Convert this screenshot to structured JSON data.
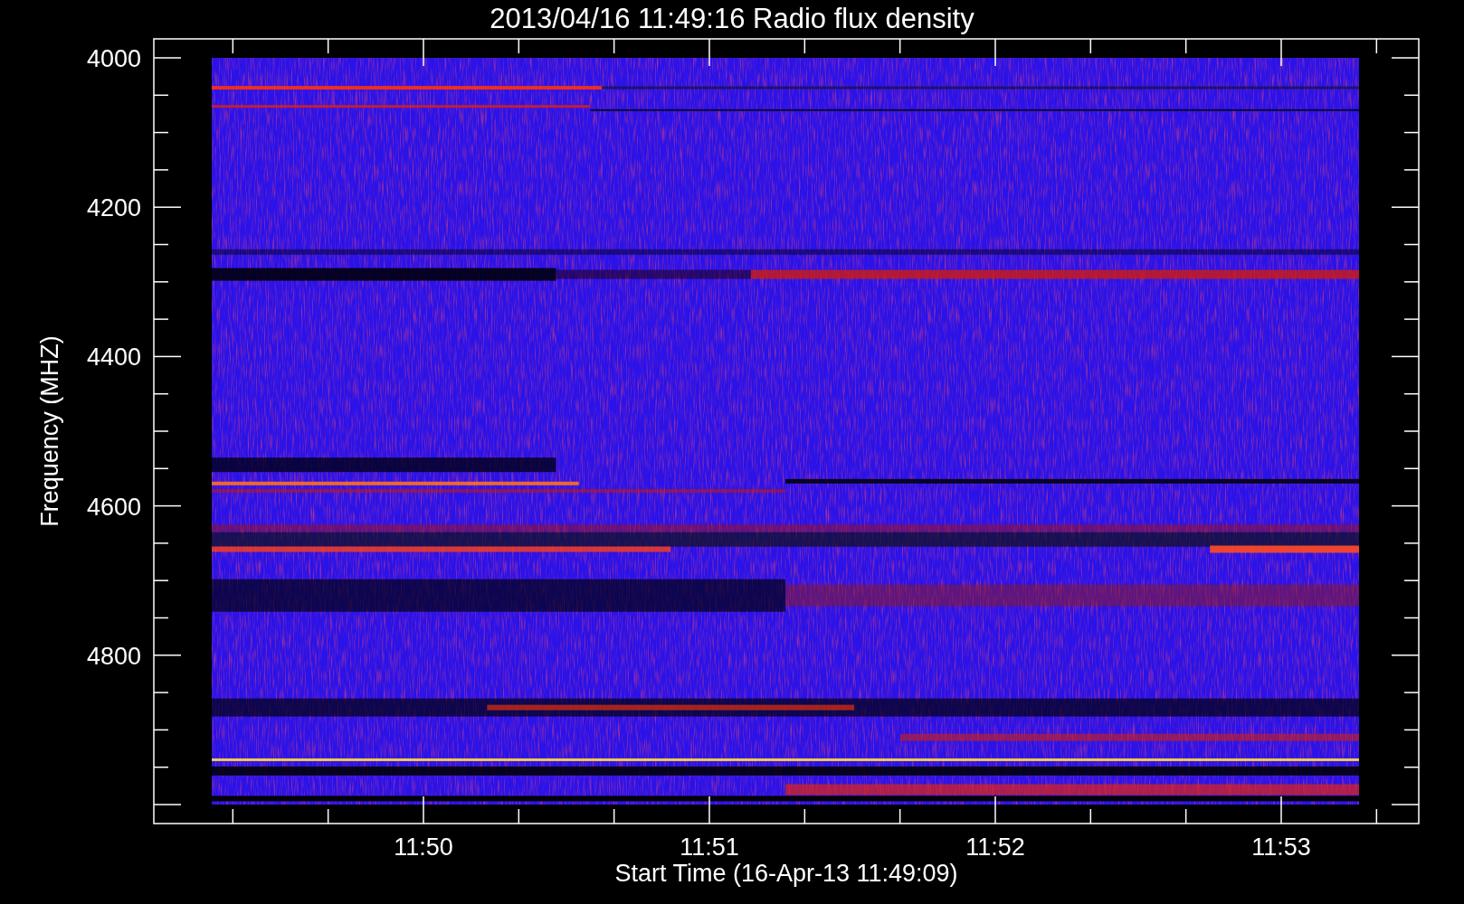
{
  "title": "2013/04/16 11:49:16 Radio flux density",
  "plot": {
    "ylabel": "Frequency (MHZ)",
    "xlabel": "Start Time (16-Apr-13 11:49:09)",
    "yticks": [
      "4000",
      "4200",
      "4400",
      "4600",
      "4800"
    ],
    "xticks": [
      "11:50",
      "11:51",
      "11:52",
      "11:53"
    ]
  }
}
